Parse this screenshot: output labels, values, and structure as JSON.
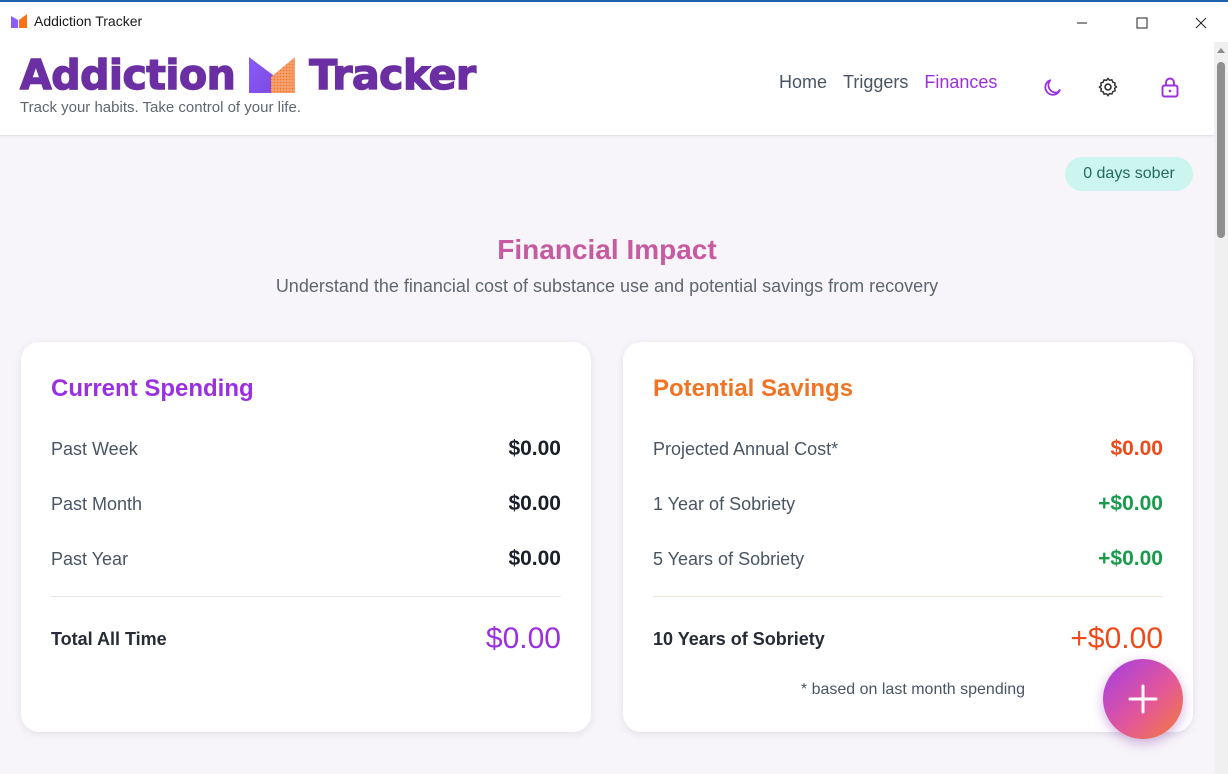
{
  "window": {
    "title": "Addiction Tracker"
  },
  "header": {
    "brand_left": "Addiction",
    "brand_right": "Tracker",
    "tagline": "Track your habits. Take control of your life.",
    "nav": [
      {
        "label": "Home",
        "active": false
      },
      {
        "label": "Triggers",
        "active": false
      },
      {
        "label": "Finances",
        "active": true
      }
    ],
    "icons": [
      "moon-icon",
      "gear-icon",
      "lock-icon"
    ]
  },
  "status": {
    "sober_badge": "0 days sober"
  },
  "section": {
    "title": "Financial Impact",
    "subtitle": "Understand the financial cost of substance use and potential savings from recovery"
  },
  "current_spending": {
    "title": "Current Spending",
    "rows": [
      {
        "label": "Past Week",
        "value": "$0.00"
      },
      {
        "label": "Past Month",
        "value": "$0.00"
      },
      {
        "label": "Past Year",
        "value": "$0.00"
      }
    ],
    "total": {
      "label": "Total All Time",
      "value": "$0.00"
    }
  },
  "potential_savings": {
    "title": "Potential Savings",
    "rows": [
      {
        "label": "Projected Annual Cost*",
        "value": "$0.00"
      },
      {
        "label": "1 Year of Sobriety",
        "value": "+$0.00"
      },
      {
        "label": "5 Years of Sobriety",
        "value": "+$0.00"
      }
    ],
    "total": {
      "label": "10 Years of Sobriety",
      "value": "+$0.00"
    },
    "footnote": "* based on last month spending"
  },
  "colors": {
    "brand": "#6b2fa3",
    "accent": "#9b30e0",
    "savings_accent": "#f07424",
    "positive": "#1a9b4c",
    "negative": "#ee4b1a"
  }
}
